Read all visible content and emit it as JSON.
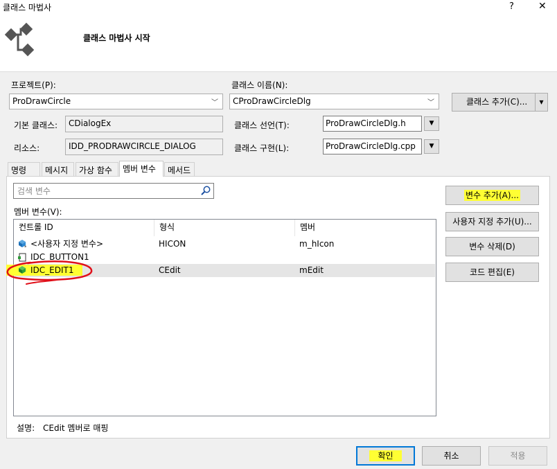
{
  "window": {
    "title": "클래스 마법사",
    "help": "?",
    "close": "✕"
  },
  "header": {
    "title": "클래스 마법사 시작",
    "icon": "class-wizard-icon"
  },
  "project": {
    "label": "프로젝트(P):",
    "value": "ProDrawCircle"
  },
  "class_name": {
    "label": "클래스 이름(N):",
    "value": "CProDrawCircleDlg"
  },
  "add_class_button": {
    "label": "클래스 추가(C)...",
    "arrow": "▾"
  },
  "base_class": {
    "label": "기본 클래스:",
    "value": "CDialogEx"
  },
  "class_decl": {
    "label": "클래스 선언(T):",
    "value": "ProDrawCircleDlg.h"
  },
  "resource": {
    "label": "리소스:",
    "value": "IDD_PRODRAWCIRCLE_DIALOG"
  },
  "class_impl": {
    "label": "클래스 구현(L):",
    "value": "ProDrawCircleDlg.cpp"
  },
  "tabs": [
    {
      "label": "명령",
      "active": false
    },
    {
      "label": "메시지",
      "active": false
    },
    {
      "label": "가상 함수",
      "active": false
    },
    {
      "label": "멤버 변수",
      "active": true
    },
    {
      "label": "메서드",
      "active": false
    }
  ],
  "search": {
    "placeholder": "검색 변수",
    "value": ""
  },
  "member_vars": {
    "label": "멤버 변수(V):",
    "columns": [
      "컨트롤 ID",
      "형식",
      "멤버"
    ],
    "rows": [
      {
        "id": "<사용자 지정 변수>",
        "type": "HICON",
        "member": "m_hIcon",
        "icon": "custom-variable-icon",
        "selected": false
      },
      {
        "id": "IDC_BUTTON1",
        "type": "",
        "member": "",
        "icon": "control-id-icon",
        "selected": false
      },
      {
        "id": "IDC_EDIT1",
        "type": "CEdit",
        "member": "mEdit",
        "icon": "control-variable-icon",
        "selected": true
      }
    ]
  },
  "side_buttons": {
    "add_variable": "변수 추가(A)...",
    "add_custom": "사용자 지정 추가(U)...",
    "delete_variable": "변수 삭제(D)",
    "edit_code": "코드 편집(E)"
  },
  "description": {
    "label": "설명:",
    "value": "CEdit 멤버로 매핑"
  },
  "footer": {
    "ok": "확인",
    "cancel": "취소",
    "apply": "적용"
  },
  "colors": {
    "highlight": "#ffff33",
    "annotation": "#e0101a",
    "focus_border": "#0078d7"
  }
}
